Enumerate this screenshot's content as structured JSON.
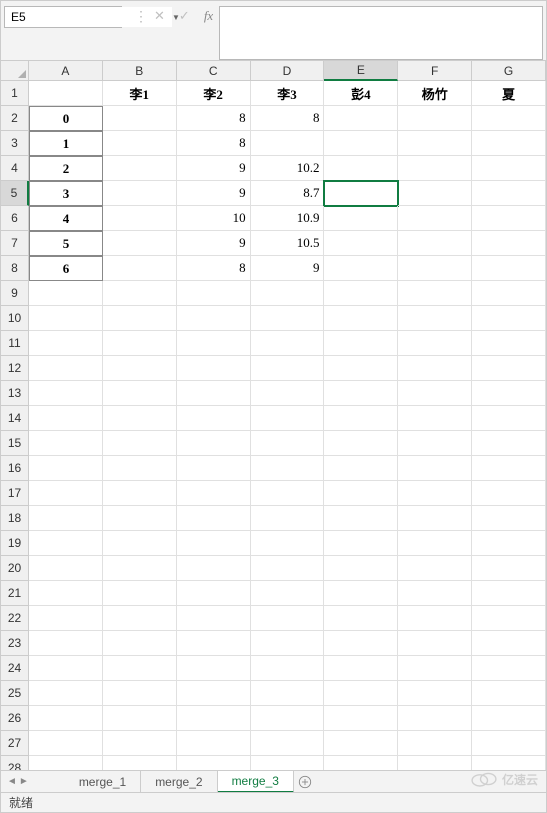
{
  "nameBox": {
    "value": "E5"
  },
  "formula": {
    "fxLabel": "fx",
    "value": ""
  },
  "columns": [
    "A",
    "B",
    "C",
    "D",
    "E",
    "F",
    "G"
  ],
  "rowCount": 28,
  "activeCell": {
    "row": 5,
    "col": 5
  },
  "selectedRow": 5,
  "selectedCol": 5,
  "headerRow": {
    "B": "李1",
    "C": "李2",
    "D": "李3",
    "E": "彭4",
    "F": "杨竹",
    "G": "夏"
  },
  "indexCol": [
    "0",
    "1",
    "2",
    "3",
    "4",
    "5",
    "6"
  ],
  "data": {
    "2": {
      "C": "8",
      "D": "8"
    },
    "3": {
      "C": "8"
    },
    "4": {
      "C": "9",
      "D": "10.2"
    },
    "5": {
      "C": "9",
      "D": "8.7"
    },
    "6": {
      "C": "10",
      "D": "10.9"
    },
    "7": {
      "C": "9",
      "D": "10.5"
    },
    "8": {
      "C": "8",
      "D": "9"
    }
  },
  "sheets": [
    {
      "name": "merge_1",
      "active": false
    },
    {
      "name": "merge_2",
      "active": false
    },
    {
      "name": "merge_3",
      "active": true
    }
  ],
  "status": {
    "text": "就绪"
  },
  "watermark": {
    "text": "亿速云"
  },
  "chart_data": {
    "type": "table",
    "columns": [
      "",
      "李1",
      "李2",
      "李3",
      "彭4",
      "杨竹"
    ],
    "rows": [
      [
        0,
        null,
        8,
        8,
        null,
        null
      ],
      [
        1,
        null,
        8,
        null,
        null,
        null
      ],
      [
        2,
        null,
        9,
        10.2,
        null,
        null
      ],
      [
        3,
        null,
        9,
        8.7,
        null,
        null
      ],
      [
        4,
        null,
        10,
        10.9,
        null,
        null
      ],
      [
        5,
        null,
        9,
        10.5,
        null,
        null
      ],
      [
        6,
        null,
        8,
        9,
        null,
        null
      ]
    ]
  }
}
